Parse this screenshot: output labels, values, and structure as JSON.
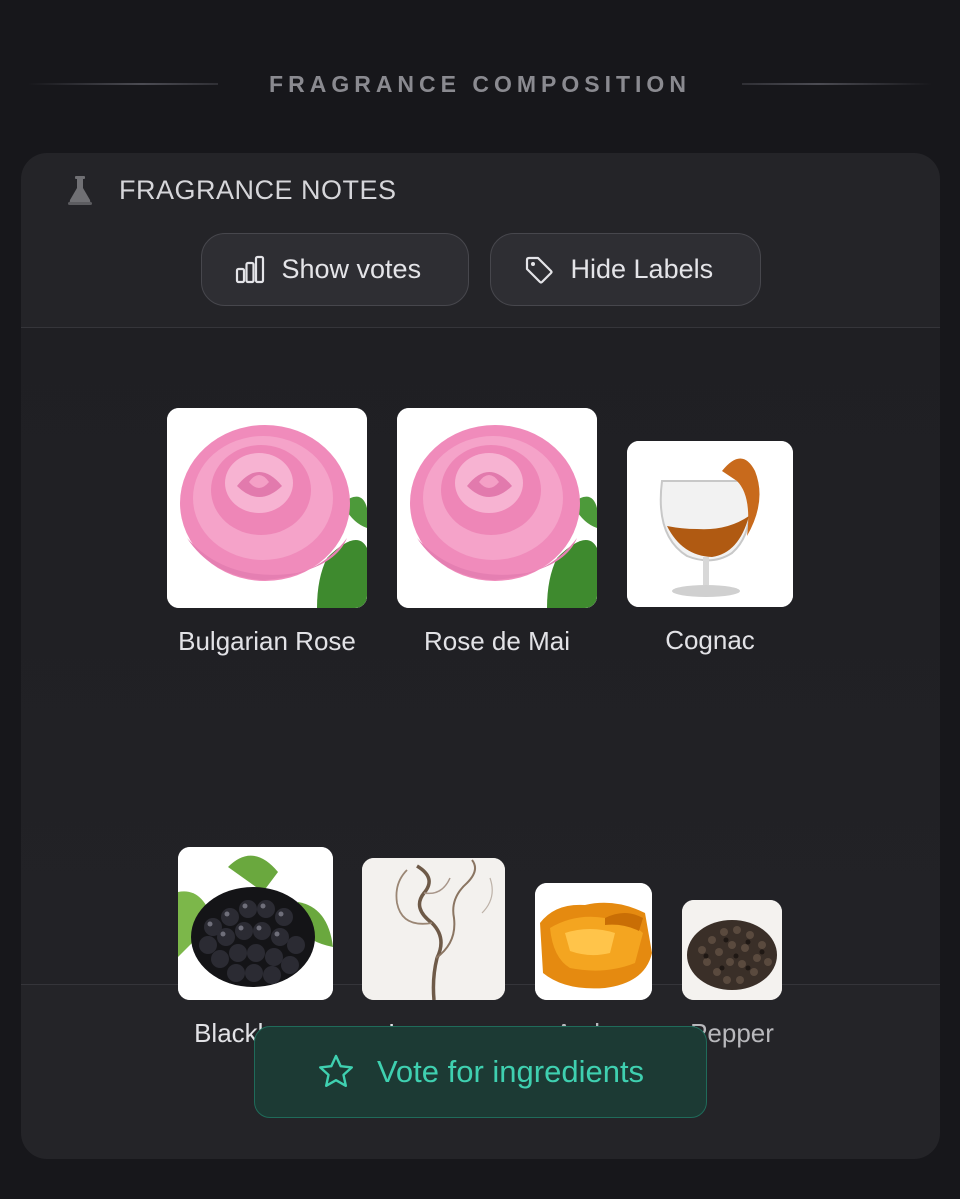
{
  "section": {
    "title": "FRAGRANCE COMPOSITION"
  },
  "card": {
    "title": "FRAGRANCE NOTES",
    "icon": "flask-icon",
    "buttons": {
      "show_votes": "Show votes",
      "hide_labels": "Hide Labels"
    }
  },
  "notes": {
    "row1": [
      {
        "name": "Bulgarian Rose",
        "icon": "rose-image"
      },
      {
        "name": "Rose de Mai",
        "icon": "rose-image"
      },
      {
        "name": "Cognac",
        "icon": "cognac-glass-image"
      }
    ],
    "row2": [
      {
        "name": "Blackberry",
        "icon": "blackberry-image"
      },
      {
        "name": "Incense",
        "icon": "smoke-image"
      },
      {
        "name": "Amber",
        "icon": "amber-image"
      },
      {
        "name": "Pepper",
        "icon": "pepper-image"
      }
    ]
  },
  "footer": {
    "vote_label": "Vote for ingredients"
  },
  "colors": {
    "background": "#17171b",
    "card": "#242428",
    "accent": "#3fd0b0",
    "accent_bg": "#1c3a34"
  }
}
